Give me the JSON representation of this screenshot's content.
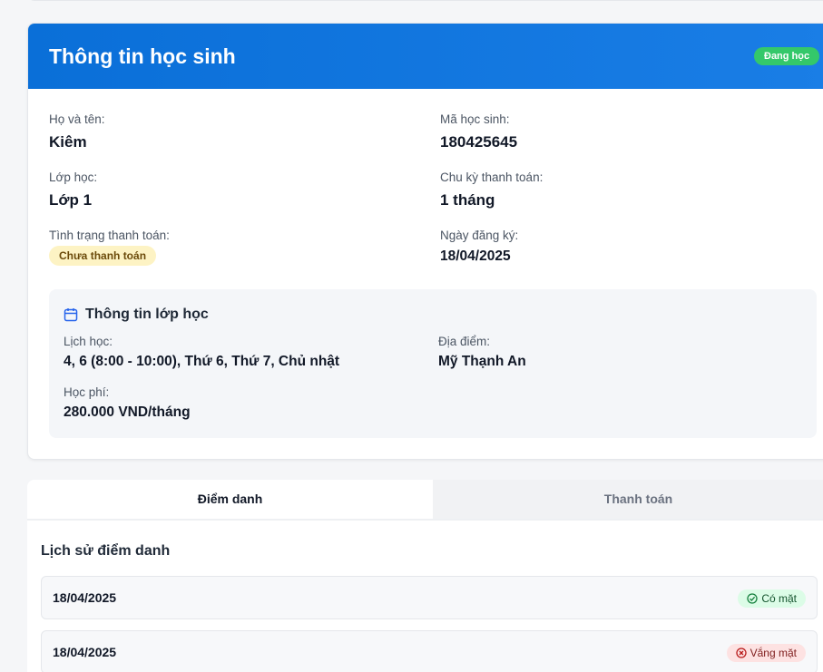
{
  "student_card": {
    "title": "Thông tin học sinh",
    "status": "Đang học",
    "fields": {
      "name_label": "Họ và tên:",
      "name_value": "Kiêm",
      "id_label": "Mã học sinh:",
      "id_value": "180425645",
      "class_label": "Lớp học:",
      "class_value": "Lớp 1",
      "cycle_label": "Chu kỳ thanh toán:",
      "cycle_value": "1 tháng",
      "payment_label": "Tình trạng thanh toán:",
      "payment_value": "Chưa thanh toán",
      "register_label": "Ngày đăng ký:",
      "register_value": "18/04/2025"
    },
    "class_info": {
      "title": "Thông tin lớp học",
      "icon": "calendar-icon",
      "schedule_label": "Lịch học:",
      "schedule_value": "4, 6 (8:00 - 10:00), Thứ 6, Thứ 7, Chủ nhật",
      "location_label": "Địa điểm:",
      "location_value": "Mỹ Thạnh An",
      "fee_label": "Học phí:",
      "fee_value": "280.000 VND/tháng"
    }
  },
  "tabs": [
    {
      "label": "Điểm danh",
      "active": true
    },
    {
      "label": "Thanh toán",
      "active": false
    }
  ],
  "attendance": {
    "title": "Lịch sử điểm danh",
    "records": [
      {
        "date": "18/04/2025",
        "status": "Có mặt",
        "type": "present",
        "icon": "check-circle-icon"
      },
      {
        "date": "18/04/2025",
        "status": "Vắng mặt",
        "type": "absent",
        "icon": "x-circle-icon"
      }
    ]
  },
  "colors": {
    "header_blue": "#0a6fd8",
    "status_green": "#34c86a",
    "unpaid_yellow": "#fdf3c4",
    "present_green": "#dcfce7",
    "absent_red": "#fde2e2"
  }
}
